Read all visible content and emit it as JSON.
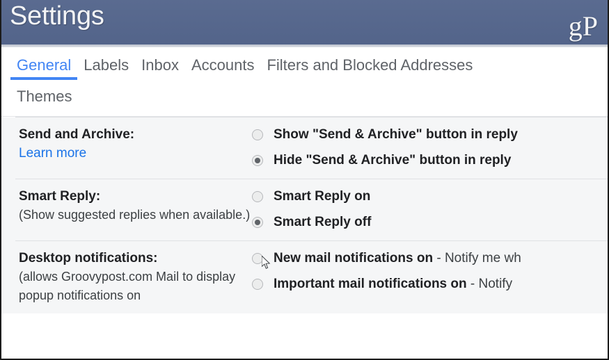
{
  "header": {
    "title": "Settings",
    "watermark": "gP",
    "bar_color": "#56678d"
  },
  "tabs": {
    "active_color": "#4285f4",
    "row1": [
      {
        "label": "General",
        "active": true
      },
      {
        "label": "Labels",
        "active": false
      },
      {
        "label": "Inbox",
        "active": false
      },
      {
        "label": "Accounts",
        "active": false
      },
      {
        "label": "Filters and Blocked Addresses",
        "active": false
      }
    ],
    "row2": [
      {
        "label": "Themes",
        "active": false
      }
    ]
  },
  "settings": [
    {
      "title": "Send and Archive:",
      "sub": "",
      "link": "Learn more",
      "options": [
        {
          "strong": "Show \"Send & Archive\" button in reply",
          "normal": "",
          "checked": false
        },
        {
          "strong": "Hide \"Send & Archive\" button in reply",
          "normal": "",
          "checked": true
        }
      ]
    },
    {
      "title": "Smart Reply:",
      "sub": "(Show suggested replies when available.)",
      "link": "",
      "options": [
        {
          "strong": "Smart Reply on",
          "normal": "",
          "checked": false
        },
        {
          "strong": "Smart Reply off",
          "normal": "",
          "checked": true
        }
      ]
    },
    {
      "title": "Desktop notifications:",
      "sub": "(allows Groovypost.com Mail to display popup notifications on",
      "link": "",
      "options": [
        {
          "strong": "New mail notifications on",
          "normal": " - Notify me wh",
          "checked": false
        },
        {
          "strong": "Important mail notifications on",
          "normal": " - Notify ",
          "checked": false
        }
      ]
    }
  ],
  "cursor": {
    "name": "mouse-pointer"
  }
}
